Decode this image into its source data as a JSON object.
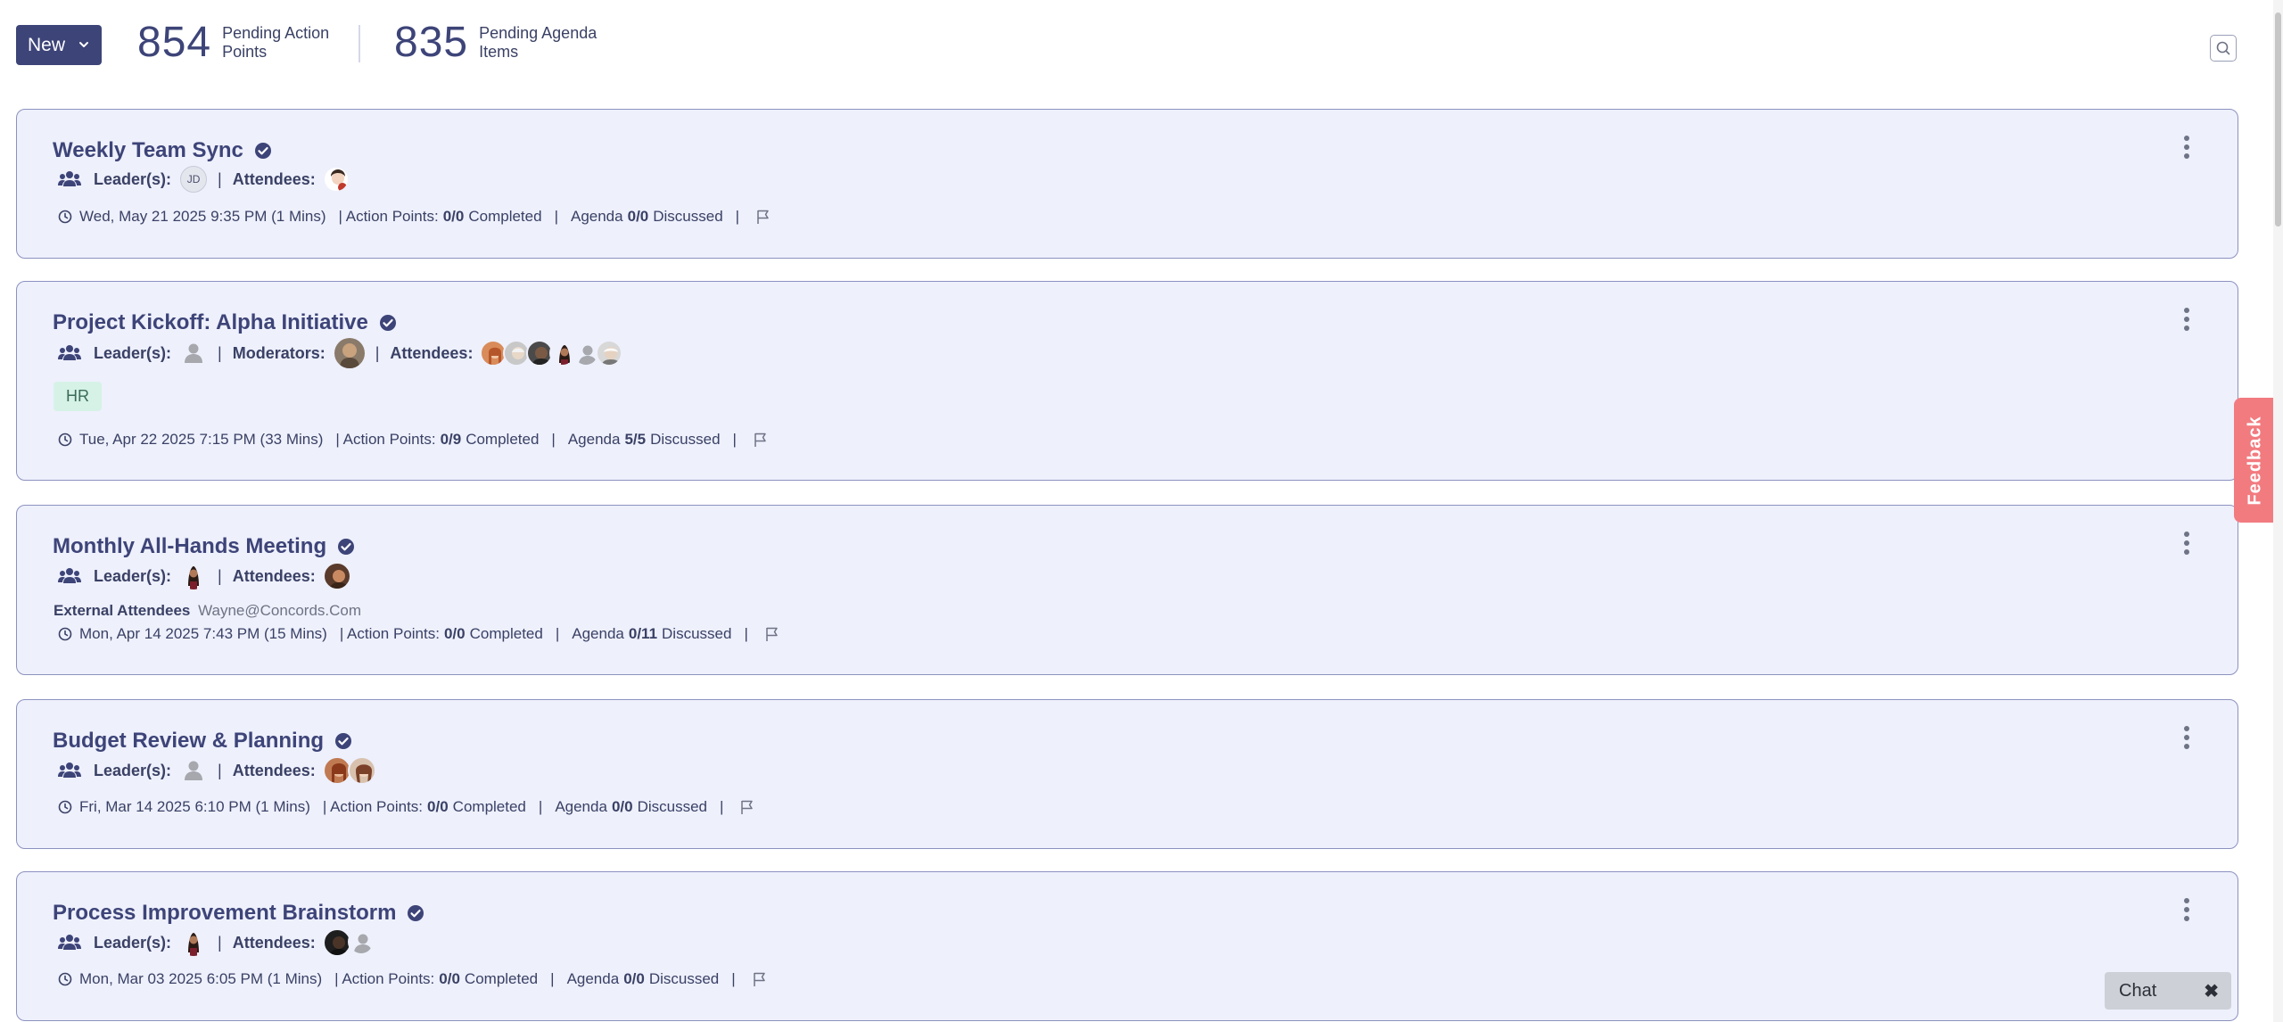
{
  "header": {
    "new_label": "New",
    "stats": [
      {
        "value": "854",
        "label": "Pending Action Points"
      },
      {
        "value": "835",
        "label": "Pending Agenda Items"
      }
    ]
  },
  "labels": {
    "leaders": "Leader(s):",
    "attendees": "Attendees:",
    "moderators": "Moderators:",
    "external_attendees": "External Attendees",
    "action_points": "| Action Points:",
    "completed": "Completed",
    "agenda": "Agenda",
    "discussed": "Discussed",
    "pipe": "|"
  },
  "meetings": [
    {
      "title": "Weekly Team Sync",
      "leader_initials": "JD",
      "datetime": "Wed, May 21 2025 9:35 PM (1 Mins)",
      "action_points": "0/0",
      "agenda": "0/0"
    },
    {
      "title": "Project Kickoff: Alpha Initiative",
      "tag": "HR",
      "datetime": "Tue, Apr 22 2025 7:15 PM (33 Mins)",
      "action_points": "0/9",
      "agenda": "5/5"
    },
    {
      "title": "Monthly All-Hands Meeting",
      "external_email": "Wayne@Concords.Com",
      "datetime": "Mon, Apr 14 2025 7:43 PM (15 Mins)",
      "action_points": "0/0",
      "agenda": "0/11"
    },
    {
      "title": "Budget Review & Planning",
      "datetime": "Fri, Mar 14 2025 6:10 PM (1 Mins)",
      "action_points": "0/0",
      "agenda": "0/0"
    },
    {
      "title": "Process Improvement Brainstorm",
      "datetime": "Mon, Mar 03 2025 6:05 PM (1 Mins)",
      "action_points": "0/0",
      "agenda": "0/0"
    }
  ],
  "feedback_label": "Feedback",
  "chat": {
    "label": "Chat",
    "close": "✖"
  },
  "colors": {
    "primary": "#3d4478",
    "card_bg": "#eef0fc",
    "card_border": "#8c92c0",
    "tag_bg": "#d6f2e6",
    "feedback": "#f27b80"
  }
}
